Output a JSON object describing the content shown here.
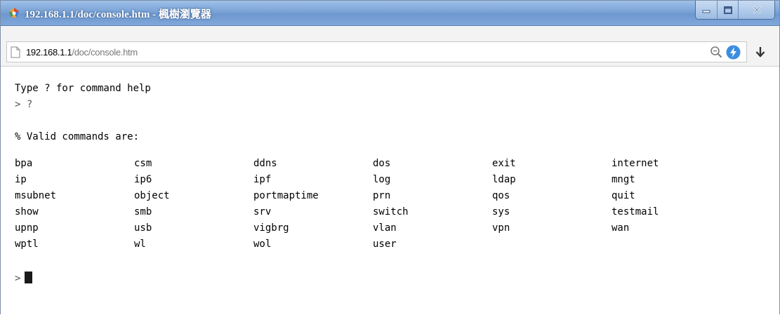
{
  "window": {
    "title": "192.168.1.1/doc/console.htm - 楓樹瀏覽器",
    "controls": {
      "minimize": "minimize-icon",
      "maximize": "maximize-icon",
      "close": "close-icon"
    }
  },
  "address_bar": {
    "url_host": "192.168.1.1",
    "url_path": "/doc/console.htm",
    "icons": [
      "page-icon",
      "search-icon",
      "bolt-icon",
      "download-icon"
    ]
  },
  "console": {
    "help_line": "Type ? for command help",
    "prompt_symbol": ">",
    "entered_command": "?",
    "valid_header": "% Valid commands are:",
    "commands": [
      "bpa",
      "csm",
      "ddns",
      "dos",
      "exit",
      "internet",
      "ip",
      "ip6",
      "ipf",
      "log",
      "ldap",
      "mngt",
      "msubnet",
      "object",
      "portmaptime",
      "prn",
      "qos",
      "quit",
      "show",
      "smb",
      "srv",
      "switch",
      "sys",
      "testmail",
      "upnp",
      "usb",
      "vigbrg",
      "vlan",
      "vpn",
      "wan",
      "wptl",
      "wl",
      "wol",
      "user"
    ]
  },
  "colors": {
    "titlebar": "#7aa3d6",
    "console_bg": "#ffffff",
    "bolt_blue": "#3b8de0"
  }
}
